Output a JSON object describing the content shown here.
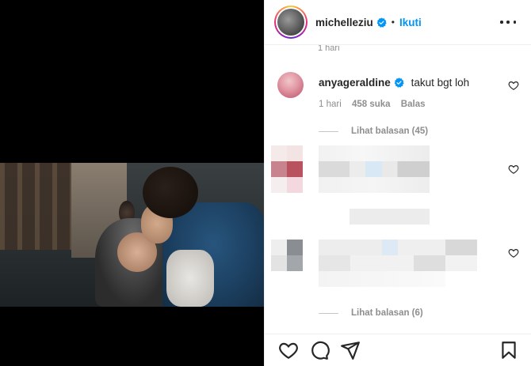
{
  "post": {
    "username": "michelleziu",
    "separator": "•",
    "follow_label": "Ikuti",
    "verified": true
  },
  "previous_comment": {
    "time": "1 hari"
  },
  "comment": {
    "username": "anyageraldine",
    "verified": true,
    "text": "takut bgt loh",
    "time": "1 hari",
    "likes": "458 suka",
    "reply_label": "Balas",
    "view_replies": "Lihat balasan (45)"
  },
  "hidden_comment_replies": "Lihat balasan (6)",
  "icons": {
    "verified": "verified-badge-icon",
    "more": "more-options-icon",
    "like": "heart-icon",
    "comment": "comment-icon",
    "share": "share-icon",
    "save": "bookmark-icon"
  },
  "colors": {
    "accent": "#0095f6",
    "text": "#262626",
    "secondary": "#8e8e8e",
    "media_bg": "#000000"
  }
}
